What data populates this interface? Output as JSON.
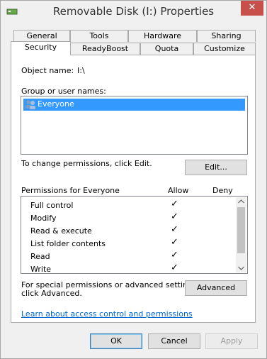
{
  "window": {
    "title": "Removable Disk (I:) Properties",
    "close_label": "✕"
  },
  "tabs_row1": [
    {
      "label": "General"
    },
    {
      "label": "Tools"
    },
    {
      "label": "Hardware"
    },
    {
      "label": "Sharing"
    }
  ],
  "tabs_row2": [
    {
      "label": "Security"
    },
    {
      "label": "ReadyBoost"
    },
    {
      "label": "Quota"
    },
    {
      "label": "Customize"
    }
  ],
  "security": {
    "object_name_label": "Object name:",
    "object_name_value": "I:\\",
    "group_label": "Group or user names:",
    "users": [
      {
        "name": "Everyone",
        "selected": true
      }
    ],
    "change_text": "To change permissions, click Edit.",
    "edit_button": "Edit...",
    "permissions_for": "Permissions for Everyone",
    "allow_header": "Allow",
    "deny_header": "Deny",
    "permissions": [
      {
        "name": "Full control",
        "allow": "✓",
        "deny": ""
      },
      {
        "name": "Modify",
        "allow": "✓",
        "deny": ""
      },
      {
        "name": "Read & execute",
        "allow": "✓",
        "deny": ""
      },
      {
        "name": "List folder contents",
        "allow": "✓",
        "deny": ""
      },
      {
        "name": "Read",
        "allow": "✓",
        "deny": ""
      },
      {
        "name": "Write",
        "allow": "✓",
        "deny": ""
      }
    ],
    "advanced_text_1": "For special permissions or advanced settings,",
    "advanced_text_2": "click Advanced.",
    "advanced_button": "Advanced",
    "learn_link": "Learn about access control and permissions"
  },
  "footer": {
    "ok": "OK",
    "cancel": "Cancel",
    "apply": "Apply"
  },
  "colors": {
    "selection": "#3399ff",
    "link": "#0066cc",
    "close": "#c7504b"
  }
}
